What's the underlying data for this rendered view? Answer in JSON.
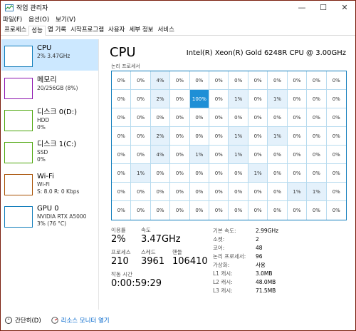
{
  "window": {
    "title": "작업 관리자",
    "minimize": "—",
    "maximize": "☐",
    "close": "✕"
  },
  "menu": [
    "파일(F)",
    "옵션(O)",
    "보기(V)"
  ],
  "tabs": [
    "프로세스",
    "성능",
    "앱 기록",
    "시작프로그램",
    "사용자",
    "세부 정보",
    "서비스"
  ],
  "sidebar": {
    "items": [
      {
        "name": "CPU",
        "sub1": "2% 3.47GHz",
        "sub2": "",
        "color": "#117dbb"
      },
      {
        "name": "메모리",
        "sub1": "20/256GB (8%)",
        "sub2": "",
        "color": "#8b12ae"
      },
      {
        "name": "디스크 0(D:)",
        "sub1": "HDD",
        "sub2": "0%",
        "color": "#4da60c"
      },
      {
        "name": "디스크 1(C:)",
        "sub1": "SSD",
        "sub2": "0%",
        "color": "#4da60c"
      },
      {
        "name": "Wi-Fi",
        "sub1": "Wi-Fi",
        "sub2": "S: 8.0  R: 0 Kbps",
        "color": "#a74f01"
      },
      {
        "name": "GPU 0",
        "sub1": "NVIDIA RTX A5000",
        "sub2": "3% (76 °C)",
        "color": "#117dbb"
      }
    ]
  },
  "cpu": {
    "title": "CPU",
    "model": "Intel(R) Xeon(R) Gold 6248R CPU @ 3.00GHz",
    "grid_label": "논리 프로세서",
    "cells": [
      [
        "0%",
        "0%",
        "4%",
        "0%",
        "0%",
        "0%",
        "0%",
        "0%",
        "0%",
        "0%",
        "0%",
        "0%"
      ],
      [
        "0%",
        "0%",
        "2%",
        "0%",
        "100%",
        "0%",
        "1%",
        "0%",
        "1%",
        "0%",
        "0%",
        "0%"
      ],
      [
        "0%",
        "0%",
        "0%",
        "0%",
        "0%",
        "0%",
        "0%",
        "0%",
        "0%",
        "0%",
        "0%",
        "0%"
      ],
      [
        "0%",
        "0%",
        "2%",
        "0%",
        "0%",
        "0%",
        "1%",
        "0%",
        "1%",
        "0%",
        "0%",
        "0%"
      ],
      [
        "0%",
        "0%",
        "4%",
        "0%",
        "1%",
        "0%",
        "1%",
        "0%",
        "0%",
        "0%",
        "0%",
        "0%"
      ],
      [
        "0%",
        "1%",
        "0%",
        "0%",
        "0%",
        "0%",
        "0%",
        "1%",
        "0%",
        "0%",
        "0%",
        "0%"
      ],
      [
        "0%",
        "0%",
        "0%",
        "0%",
        "0%",
        "0%",
        "0%",
        "0%",
        "0%",
        "1%",
        "1%",
        "0%"
      ],
      [
        "0%",
        "0%",
        "0%",
        "0%",
        "0%",
        "0%",
        "0%",
        "0%",
        "0%",
        "0%",
        "0%",
        "0%"
      ]
    ],
    "utilization_label": "이용률",
    "utilization": "2%",
    "speed_label": "속도",
    "speed": "3.47GHz",
    "processes_label": "프로세스",
    "processes": "210",
    "threads_label": "스레드",
    "threads": "3961",
    "handles_label": "핸들",
    "handles": "106410",
    "uptime_label": "작동 시간",
    "uptime": "0:00:59:29",
    "details": [
      {
        "k": "기본 속도:",
        "v": "2.99GHz"
      },
      {
        "k": "소켓:",
        "v": "2"
      },
      {
        "k": "코어:",
        "v": "48"
      },
      {
        "k": "논리 프로세서:",
        "v": "96"
      },
      {
        "k": "가상화:",
        "v": "사용"
      },
      {
        "k": "L1 캐시:",
        "v": "3.0MB"
      },
      {
        "k": "L2 캐시:",
        "v": "48.0MB"
      },
      {
        "k": "L3 캐시:",
        "v": "71.5MB"
      }
    ]
  },
  "footer": {
    "fewer_details": "간단히(D)",
    "resource_monitor": "리소스 모니터 열기"
  }
}
